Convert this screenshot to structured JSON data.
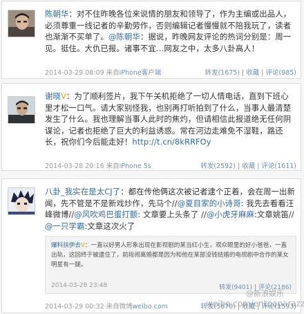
{
  "posts": [
    {
      "author": "陈朝华",
      "text": "：对不住昨晚各位来说情的朋友和领导了，作为主编或出品人，必须尊重一线记者的辛勤劳作，否则编辑记者慢慢就不陪我玩了，读者也渐渐不买单了。",
      "mention": "@陈朝华",
      "text2": "：据说，昨晚网友评论的热词分别是：周一见。挺住。大仇已报。诸事不宜…网友之中，太多八卦高人！",
      "time": "2014-03-29 08:09",
      "source_prefix": "来自",
      "source": "iPhone客户端",
      "forward_label": "转发(1675)",
      "fav_label": "收藏",
      "comment_label": "评论(985)"
    },
    {
      "author": "谢晓",
      "text": "：为了顺利签片，我下午关机拒绝了一切人情电话，直到下班心里才松一口气。请大家别怪我，也别再打听拍到了什么，当事人最清楚发生了什么。我也理解当事人此时的焦灼，但请相信此报道绝无任何阴谋论，记者也拒绝了巨大的利益诱惑。常在河边走难免不湿鞋，路还长，祝你们今后能走好！",
      "link": "http://t.cn/8kRRFOy",
      "time": "2014-03-28 20:16",
      "source_prefix": "来自",
      "source": "iPhone 5s",
      "forward_label": "转发(2592)",
      "fav_label": "收藏",
      "comment_label": "评论(1611)"
    },
    {
      "author": "八卦_我实在是太CJ了",
      "text1": "：都在传他俩这次被记者逮个正着，会在周一出新闻，先不管是不是新戏炒作，先马个//",
      "m1": "@夏目家的小诗哥",
      "t2": ": 我先去看看汪峰微博//",
      "m2": "@风吹鸡巴蛋打颤",
      "t3": ": 文章要上头条了 //",
      "m3": "@小虎牙麻麻",
      "t4": ":文章姚笛//",
      "m4": "@一只学霸",
      "t5": ":文章这次火了",
      "retweet": {
        "author": "爆料扶伊去",
        "text": "：一直以好男人形象出现在影视剧的某当红小生，观众眼里的好小爸爸，一直出轨，这回终于被逮住了，前段闹离婚都是因为和他在某部没钱结婚的电视剧中合作的某女明星有一腿。",
        "time": "2014-03-28 23:48",
        "forward_label": "转发(9401)",
        "comment_label": "评论(2186)"
      },
      "time": "2014-03-29 00:32",
      "source_prefix": "来自微博",
      "source": "weibo.com",
      "forward_label": "转发(5670)",
      "fav_label": "收藏",
      "comment_label": "评论(1593)"
    }
  ],
  "watermark": {
    "brand": "@新浪娱乐",
    "url": "weibo.com/entpaparazzi"
  }
}
